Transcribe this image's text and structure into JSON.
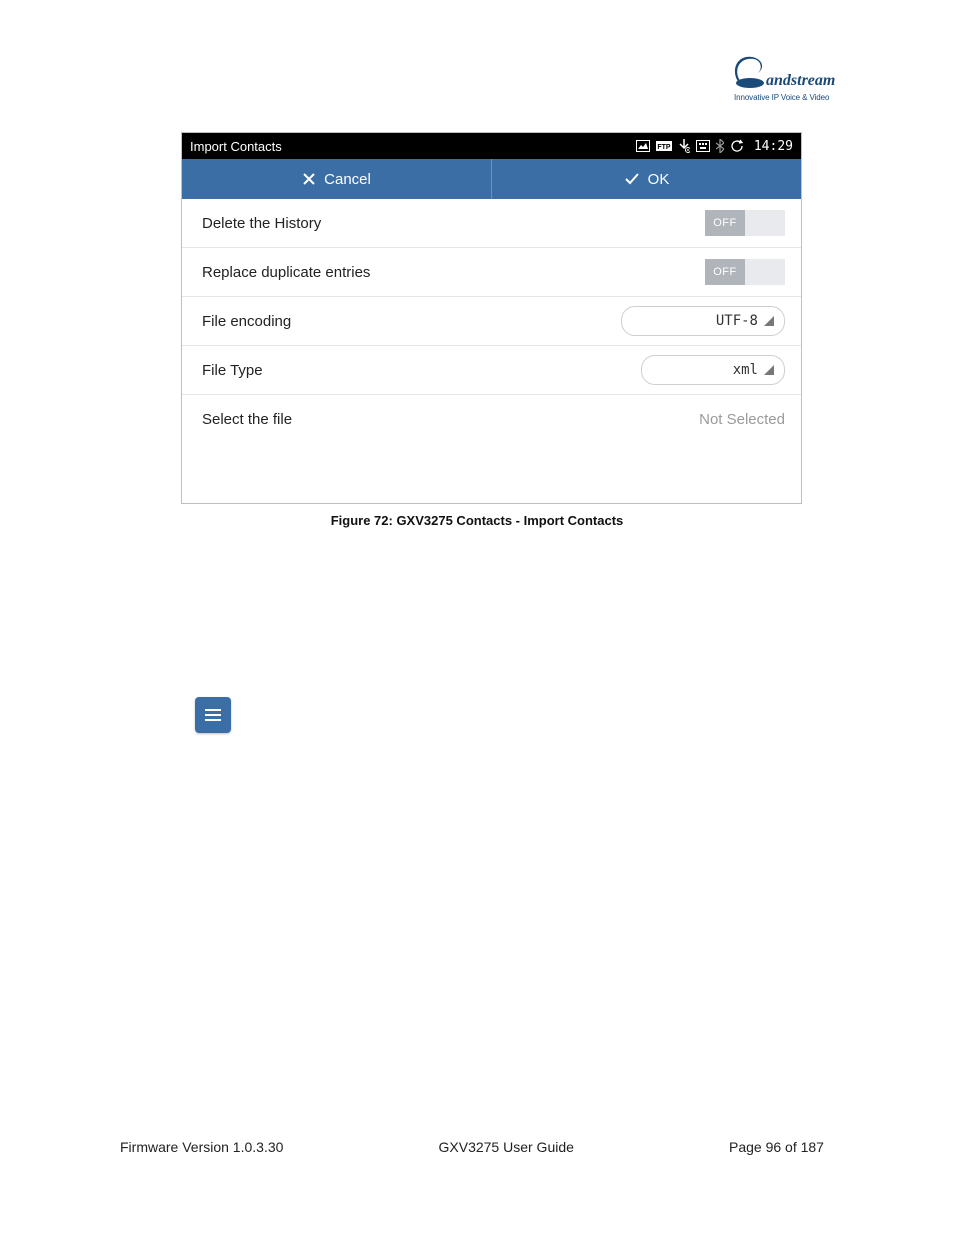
{
  "logo": {
    "name": "Grandstream",
    "tagline": "Innovative IP Voice & Video"
  },
  "screenshot": {
    "statusbar": {
      "title": "Import Contacts",
      "time": "14:29"
    },
    "actions": {
      "cancel": "Cancel",
      "ok": "OK"
    },
    "rows": {
      "delete_history": {
        "label": "Delete the History",
        "toggle": "OFF"
      },
      "replace_dup": {
        "label": "Replace duplicate entries",
        "toggle": "OFF"
      },
      "file_encoding": {
        "label": "File encoding",
        "value": "UTF-8"
      },
      "file_type": {
        "label": "File Type",
        "value": "xml"
      },
      "select_file": {
        "label": "Select the file",
        "value": "Not Selected"
      }
    }
  },
  "caption": "Figure 72: GXV3275 Contacts - Import Contacts",
  "footer": {
    "left": "Firmware Version 1.0.3.30",
    "center": "GXV3275 User Guide",
    "right": "Page 96 of 187"
  }
}
